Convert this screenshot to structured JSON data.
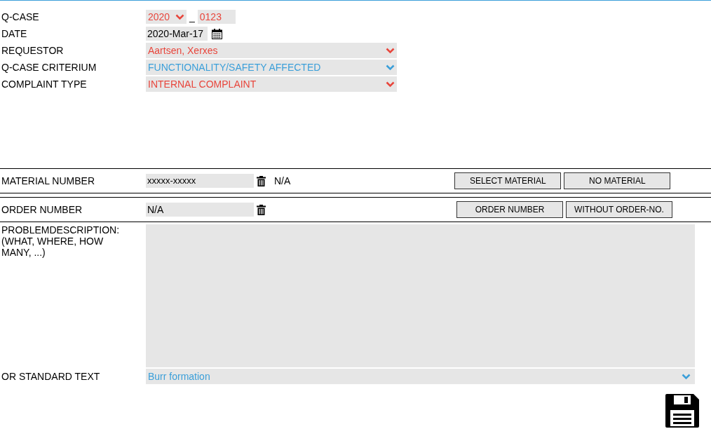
{
  "header": {
    "qcase": {
      "label": "Q-CASE",
      "year": "2020",
      "separator": "_",
      "number": "0123",
      "color": "#e8463c"
    },
    "date": {
      "label": "DATE",
      "value": "2020-Mar-17"
    },
    "selects": [
      {
        "label": "REQUESTOR",
        "value": "Aartsen, Xerxes",
        "color": "#e8463c"
      },
      {
        "label": "Q-CASE CRITERIUM",
        "value": "FUNCTIONALITY/SAFETY AFFECTED",
        "color": "#3b9fd9"
      },
      {
        "label": "COMPLAINT TYPE",
        "value": "INTERNAL COMPLAINT",
        "color": "#e8463c"
      }
    ]
  },
  "material": {
    "label": "MATERIAL NUMBER",
    "value": "xxxxx-xxxxx",
    "info": "N/A",
    "buttons": [
      "SELECT MATERIAL",
      "NO MATERIAL"
    ]
  },
  "order": {
    "label": "ORDER NUMBER",
    "value": "N/A",
    "buttons": [
      "ORDER NUMBER",
      "WITHOUT ORDER-NO."
    ]
  },
  "problem": {
    "label": "PROBLEMDESCRIPTION: (WHAT, WHERE, HOW MANY, ...)"
  },
  "standard_text": {
    "label": "OR STANDARD TEXT",
    "value": "Burr formation",
    "color": "#3b9fd9"
  }
}
